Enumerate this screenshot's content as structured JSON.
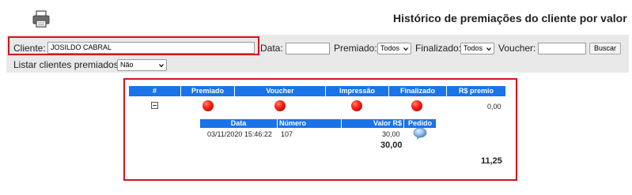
{
  "header": {
    "title": "Histórico de premiações do cliente por valor",
    "print_icon": "printer-icon"
  },
  "filters": {
    "cliente_label": "Cliente:",
    "cliente_value": "JOSILDO CABRAL",
    "data_label": "Data:",
    "data_value": "",
    "premiado_label": "Premiado:",
    "premiado_value": "Todos",
    "finalizado_label": "Finalizado:",
    "finalizado_value": "Todos",
    "voucher_label": "Voucher:",
    "voucher_value": "",
    "buscar_label": "Buscar",
    "listar_label": "Listar clientes premiados:",
    "listar_value": "Não"
  },
  "grid": {
    "columns": [
      "#",
      "Premiado",
      "Voucher",
      "Impressão",
      "Finalizado",
      "R$ premio"
    ],
    "row": {
      "toggle_icon": "collapse-minus-icon",
      "premiado_status": "red",
      "voucher_status": "red",
      "impressao_status": "red",
      "finalizado_status": "red",
      "premio": "0,00"
    },
    "detail": {
      "columns": [
        "Data",
        "Número",
        "Valor R$",
        "Pedido"
      ],
      "rows": [
        {
          "data": "03/11/2020 15:46:22",
          "numero": "107",
          "valor": "30,00",
          "pedido_icon": "chat-bubble-icon"
        }
      ],
      "subtotal": "30,00"
    },
    "total": "11,25"
  },
  "colors": {
    "accent_blue": "#1a73e8",
    "highlight_red": "#d0151c",
    "status_red": "#e00000",
    "filter_bar_bg": "#e9e9e9"
  }
}
